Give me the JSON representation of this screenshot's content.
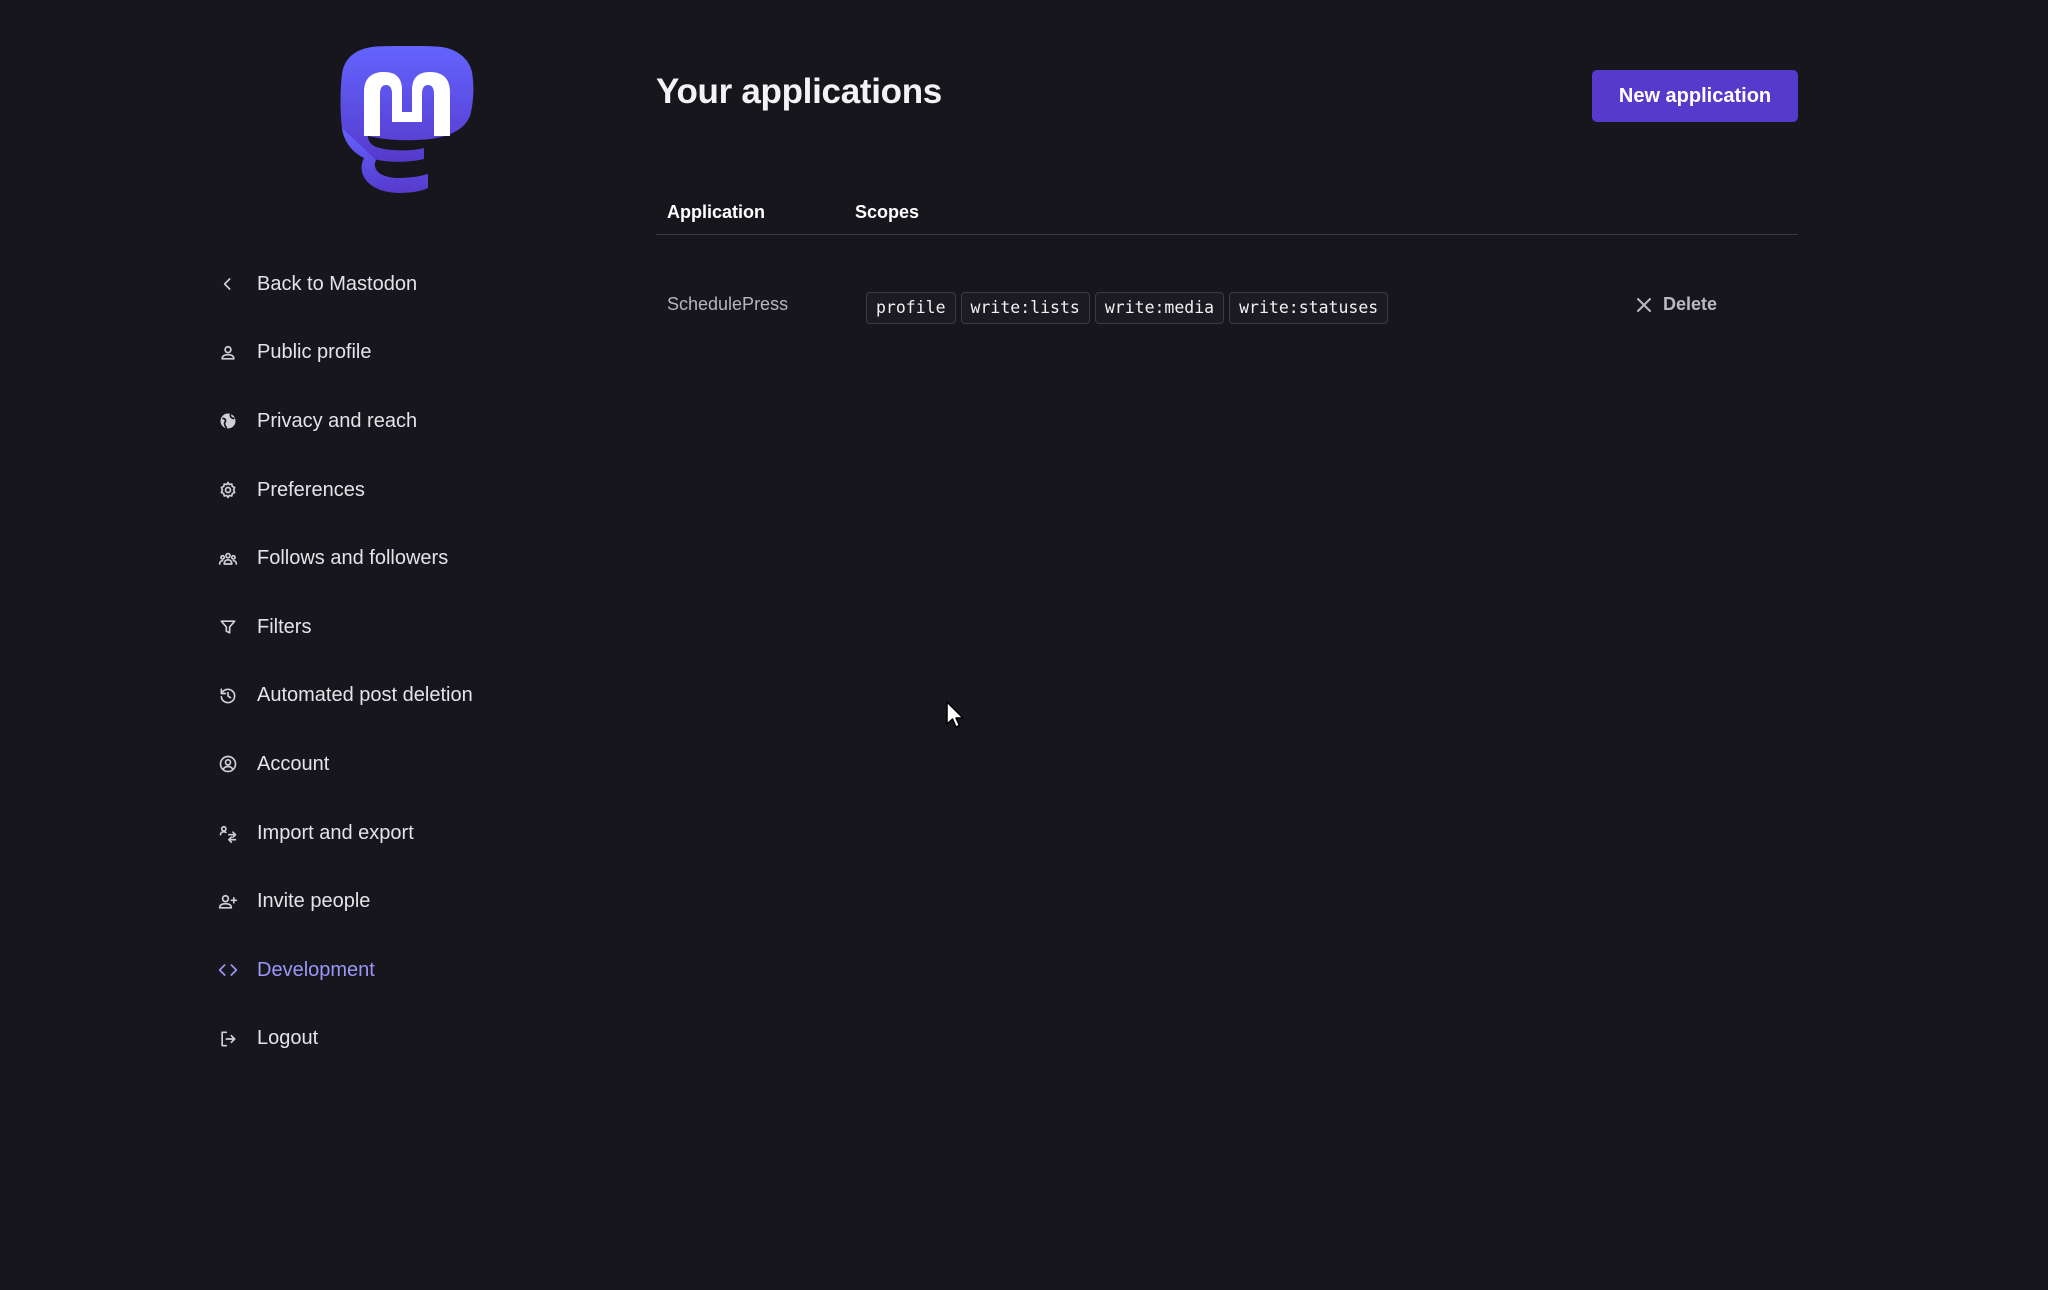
{
  "brand": {
    "accent": "#563acc",
    "logo_icon": "mastodon-logo-icon",
    "active_color": "#9b97f8"
  },
  "sidebar": {
    "items": [
      {
        "label": "Back to Mastodon",
        "icon": "chevron-left-icon",
        "active": false
      },
      {
        "label": "Public profile",
        "icon": "person-icon",
        "active": false
      },
      {
        "label": "Privacy and reach",
        "icon": "globe-icon",
        "active": false
      },
      {
        "label": "Preferences",
        "icon": "gear-icon",
        "active": false
      },
      {
        "label": "Follows and followers",
        "icon": "group-icon",
        "active": false
      },
      {
        "label": "Filters",
        "icon": "filter-icon",
        "active": false
      },
      {
        "label": "Automated post deletion",
        "icon": "history-icon",
        "active": false
      },
      {
        "label": "Account",
        "icon": "account-circle-icon",
        "active": false
      },
      {
        "label": "Import and export",
        "icon": "import-export-icon",
        "active": false
      },
      {
        "label": "Invite people",
        "icon": "person-add-icon",
        "active": false
      },
      {
        "label": "Development",
        "icon": "code-icon",
        "active": true
      },
      {
        "label": "Logout",
        "icon": "logout-icon",
        "active": false
      }
    ]
  },
  "main": {
    "title": "Your applications",
    "new_app_label": "New application",
    "table": {
      "headers": {
        "application": "Application",
        "scopes": "Scopes"
      },
      "rows": [
        {
          "name": "SchedulePress",
          "scopes": [
            "profile",
            "write:lists",
            "write:media",
            "write:statuses"
          ],
          "delete_label": "Delete"
        }
      ]
    }
  }
}
